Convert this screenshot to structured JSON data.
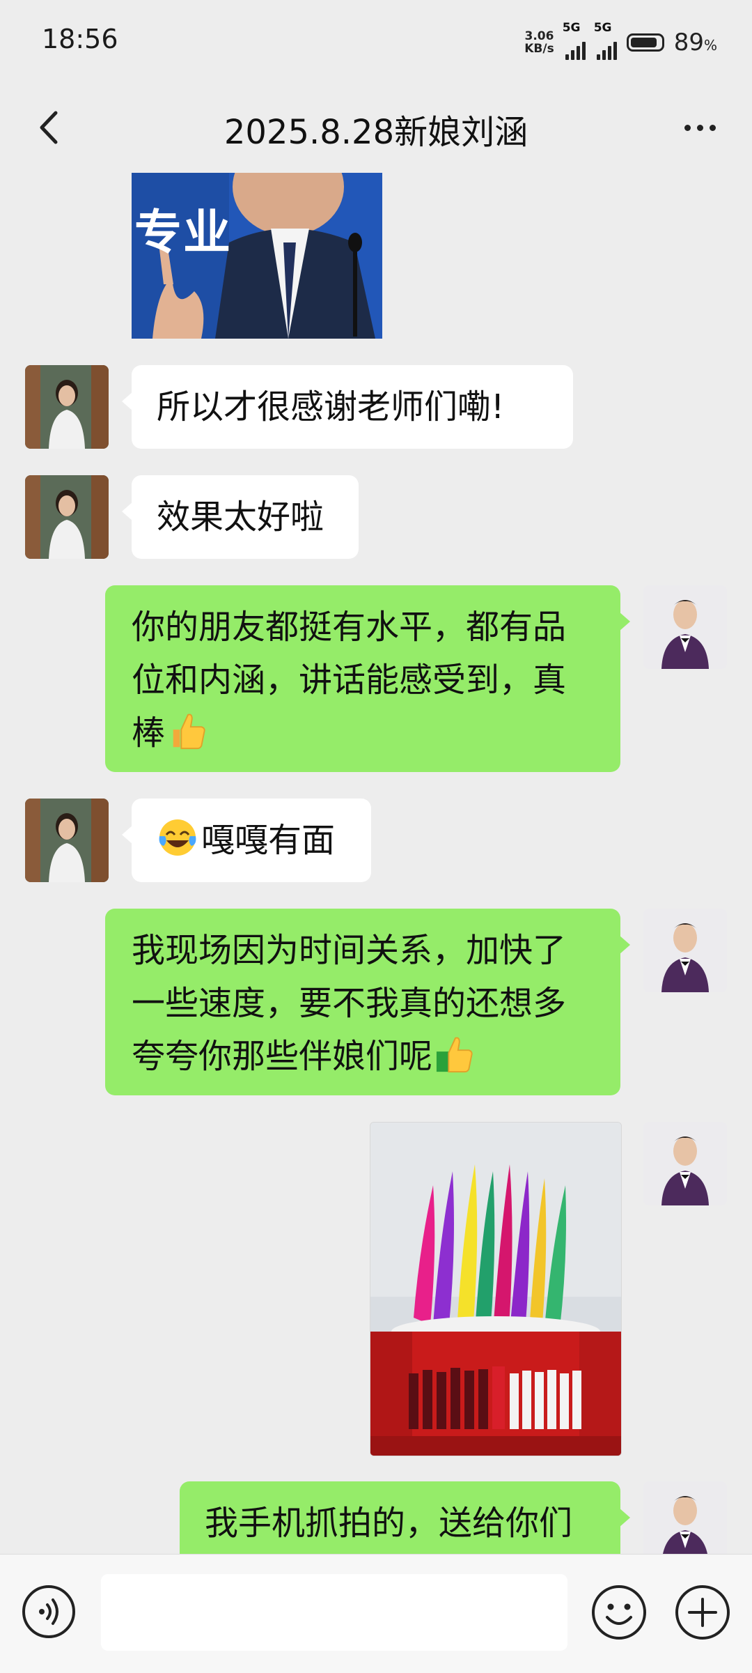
{
  "status": {
    "time": "18:56",
    "speed_value": "3.06",
    "speed_unit": "KB/s",
    "network1": "5G",
    "network2": "5G",
    "battery": "89",
    "battery_unit": "%"
  },
  "nav": {
    "title": "2025.8.28新娘刘涵",
    "back_icon": "chevron-left-icon",
    "more_icon": "more-dots-icon"
  },
  "messages": [
    {
      "from": "other",
      "type": "image",
      "image_text": "专业"
    },
    {
      "from": "other",
      "type": "text",
      "text": "所以才很感谢老师们嘞!"
    },
    {
      "from": "other",
      "type": "text",
      "text": "效果太好啦"
    },
    {
      "from": "self",
      "type": "text",
      "lines": [
        "你的朋友都挺有水平，都有品",
        "位和内涵，讲话能感受到，真",
        "棒"
      ],
      "emoji_end": "thumbs-up-icon"
    },
    {
      "from": "other",
      "type": "text",
      "emoji_start": "laughing-tears-icon",
      "text": "嘎嘎有面"
    },
    {
      "from": "self",
      "type": "text",
      "lines": [
        "我现场因为时间关系，加快了",
        "一些速度，要不我真的还想多",
        "夸夸你那些伴娘们呢"
      ],
      "emoji_end": "thumbs-up-icon"
    },
    {
      "from": "self",
      "type": "image",
      "image_desc": "colorful-smoke-wedding-photo"
    },
    {
      "from": "self",
      "type": "text",
      "text": "我手机抓拍的，送给你们"
    }
  ],
  "input": {
    "placeholder": "",
    "voice_icon": "voice-icon",
    "emoji_icon": "emoji-icon",
    "plus_icon": "plus-icon"
  },
  "colors": {
    "background": "#ededed",
    "bubble_self": "#95ec69",
    "bubble_other": "#ffffff"
  }
}
